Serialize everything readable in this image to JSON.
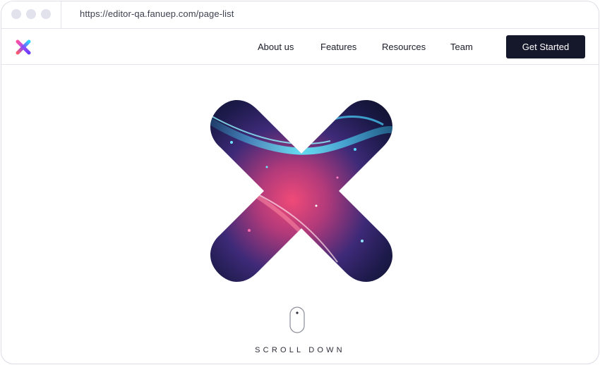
{
  "browser": {
    "url": "https://editor-qa.fanuep.com/page-list"
  },
  "nav": {
    "links": [
      "About us",
      "Features",
      "Resources",
      "Team"
    ],
    "cta_label": "Get Started"
  },
  "hero": {
    "scroll_label": "SCROLL DOWN"
  },
  "colors": {
    "cta_background": "#15172a",
    "logo_gradient": [
      "#ff4fa0",
      "#7b4dff",
      "#2fd2ff"
    ]
  },
  "icons": {
    "logo": "x-logo-icon",
    "hero": "hero-x-graphic",
    "scroll": "mouse-scroll-icon"
  }
}
